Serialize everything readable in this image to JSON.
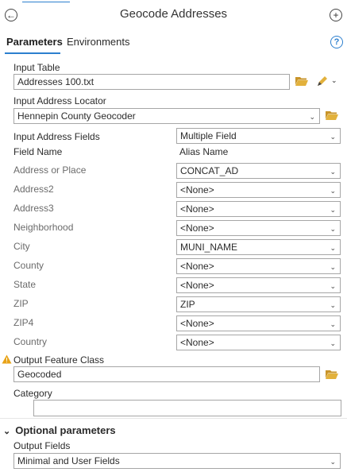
{
  "header": {
    "title": "Geocode Addresses"
  },
  "tabs": [
    {
      "label": "Parameters",
      "active": true
    },
    {
      "label": "Environments",
      "active": false
    }
  ],
  "params": {
    "input_table": {
      "label": "Input Table",
      "value": "Addresses 100.txt"
    },
    "locator": {
      "label": "Input Address Locator",
      "value": "Hennepin County Geocoder"
    },
    "fields": {
      "label": "Input Address Fields",
      "value": "Multiple Field"
    },
    "col_field_name": "Field Name",
    "col_alias_name": "Alias Name",
    "rows": [
      {
        "field": "Address or Place",
        "alias": "CONCAT_AD"
      },
      {
        "field": "Address2",
        "alias": "<None>"
      },
      {
        "field": "Address3",
        "alias": "<None>"
      },
      {
        "field": "Neighborhood",
        "alias": "<None>"
      },
      {
        "field": "City",
        "alias": "MUNI_NAME"
      },
      {
        "field": "County",
        "alias": "<None>"
      },
      {
        "field": "State",
        "alias": "<None>"
      },
      {
        "field": "ZIP",
        "alias": "ZIP"
      },
      {
        "field": "ZIP4",
        "alias": "<None>"
      },
      {
        "field": "Country",
        "alias": "<None>"
      }
    ],
    "output_fc": {
      "label": "Output Feature Class",
      "value": "Geocoded"
    },
    "category": {
      "label": "Category",
      "value": ""
    }
  },
  "optional": {
    "section_label": "Optional parameters",
    "output_fields": {
      "label": "Output Fields",
      "value": "Minimal and User Fields"
    }
  },
  "colors": {
    "accent": "#2c7fce",
    "folder": "#e2b13c",
    "warning": "#e8a317"
  }
}
